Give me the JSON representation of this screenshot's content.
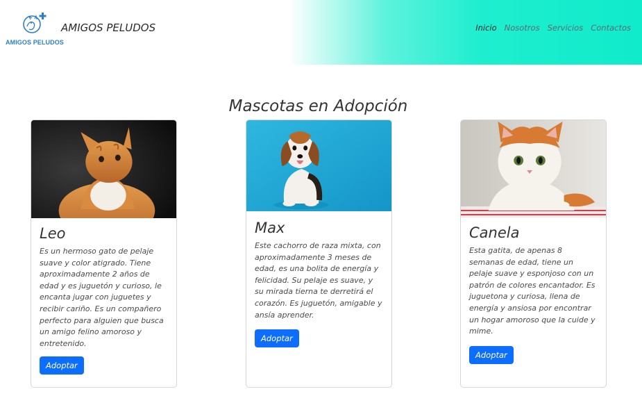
{
  "header": {
    "logo_text": "AMIGOS PELUDOS",
    "brand": "AMIGOS PELUDOS",
    "nav": [
      {
        "label": "Inicio",
        "active": true
      },
      {
        "label": "Nosotros",
        "active": false
      },
      {
        "label": "Servicios",
        "active": false
      },
      {
        "label": "Contactos",
        "active": false
      }
    ]
  },
  "main": {
    "title": "Mascotas en Adopción",
    "cards": [
      {
        "name": "Leo",
        "image": "orange-tabby-cat-photo",
        "description": "Es un hermoso gato de pelaje suave y color atigrado. Tiene aproximadamente 2 años de edad y es juguetón y curioso, le encanta jugar con juguetes y recibir cariño. Es un compañero perfecto para alguien que busca un amigo felino amoroso y entretenido.",
        "button": "Adoptar"
      },
      {
        "name": "Max",
        "image": "beagle-puppy-photo",
        "description": "Este cachorro de raza mixta, con aproximadamente 3 meses de edad, es una bolita de energía y felicidad. Su pelaje es suave, y su mirada tierna te derretirá el corazón. Es juguetón, amigable y ansía aprender.",
        "button": "Adoptar"
      },
      {
        "name": "Canela",
        "image": "orange-white-kitten-photo",
        "description": "Esta gatita, de apenas 8 semanas de edad, tiene un pelaje suave y esponjoso con un patrón de colores encantador. Es juguetona y curiosa, llena de energía y ansiosa por encontrar un hogar amoroso que la cuide y mime.",
        "button": "Adoptar"
      }
    ]
  },
  "colors": {
    "accent": "#0d6efd",
    "header_gradient": "#10ebcb",
    "logo_blue": "#2a7fc8"
  }
}
